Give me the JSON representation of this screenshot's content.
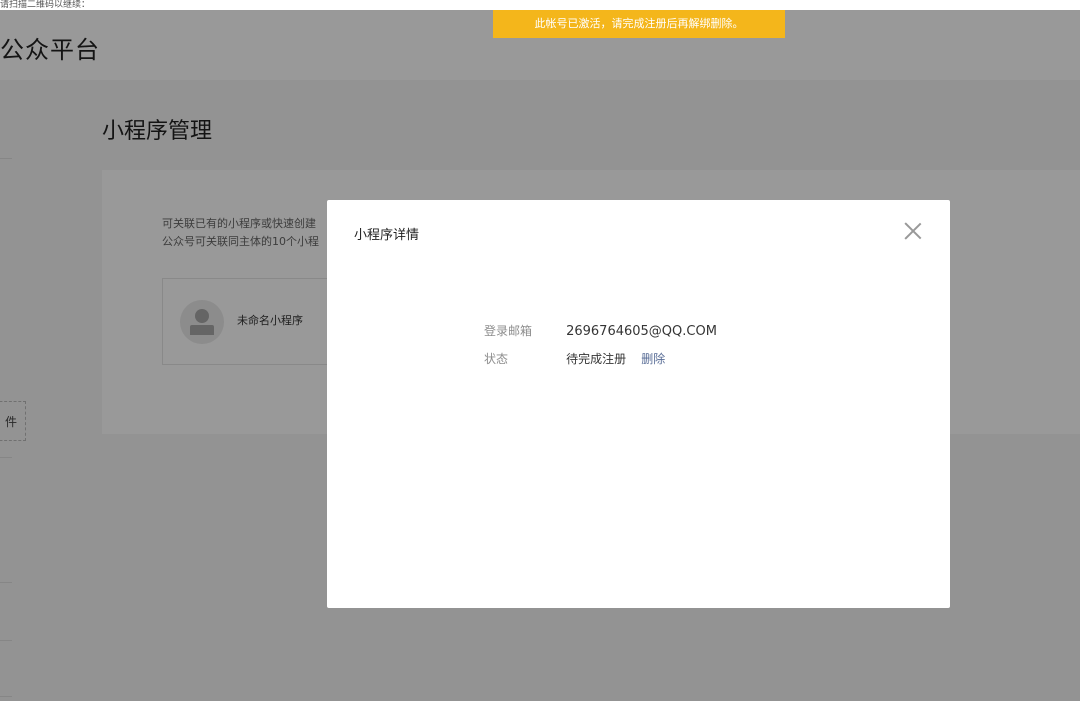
{
  "top_strip": {
    "text": "请扫描二维码以继续："
  },
  "header": {
    "brand": "公众平台"
  },
  "banner": {
    "text": "此帐号已激活，请完成注册后再解绑删除。",
    "color": "#f4b61b"
  },
  "sidebar": {
    "plugin_label": "件"
  },
  "page": {
    "title": "小程序管理",
    "description_lines": [
      "可关联已有的小程序或快速创建",
      "公众号可关联同主体的10个小程"
    ],
    "app": {
      "name": "未命名小程序",
      "avatar_icon": "user-avatar-icon"
    }
  },
  "dialog": {
    "title": "小程序详情",
    "close_icon": "close-icon",
    "email_label": "登录邮箱",
    "email_value": "2696764605@QQ.COM",
    "status_label": "状态",
    "status_value": "待完成注册",
    "delete_link": "删除",
    "link_color": "#576b95"
  }
}
